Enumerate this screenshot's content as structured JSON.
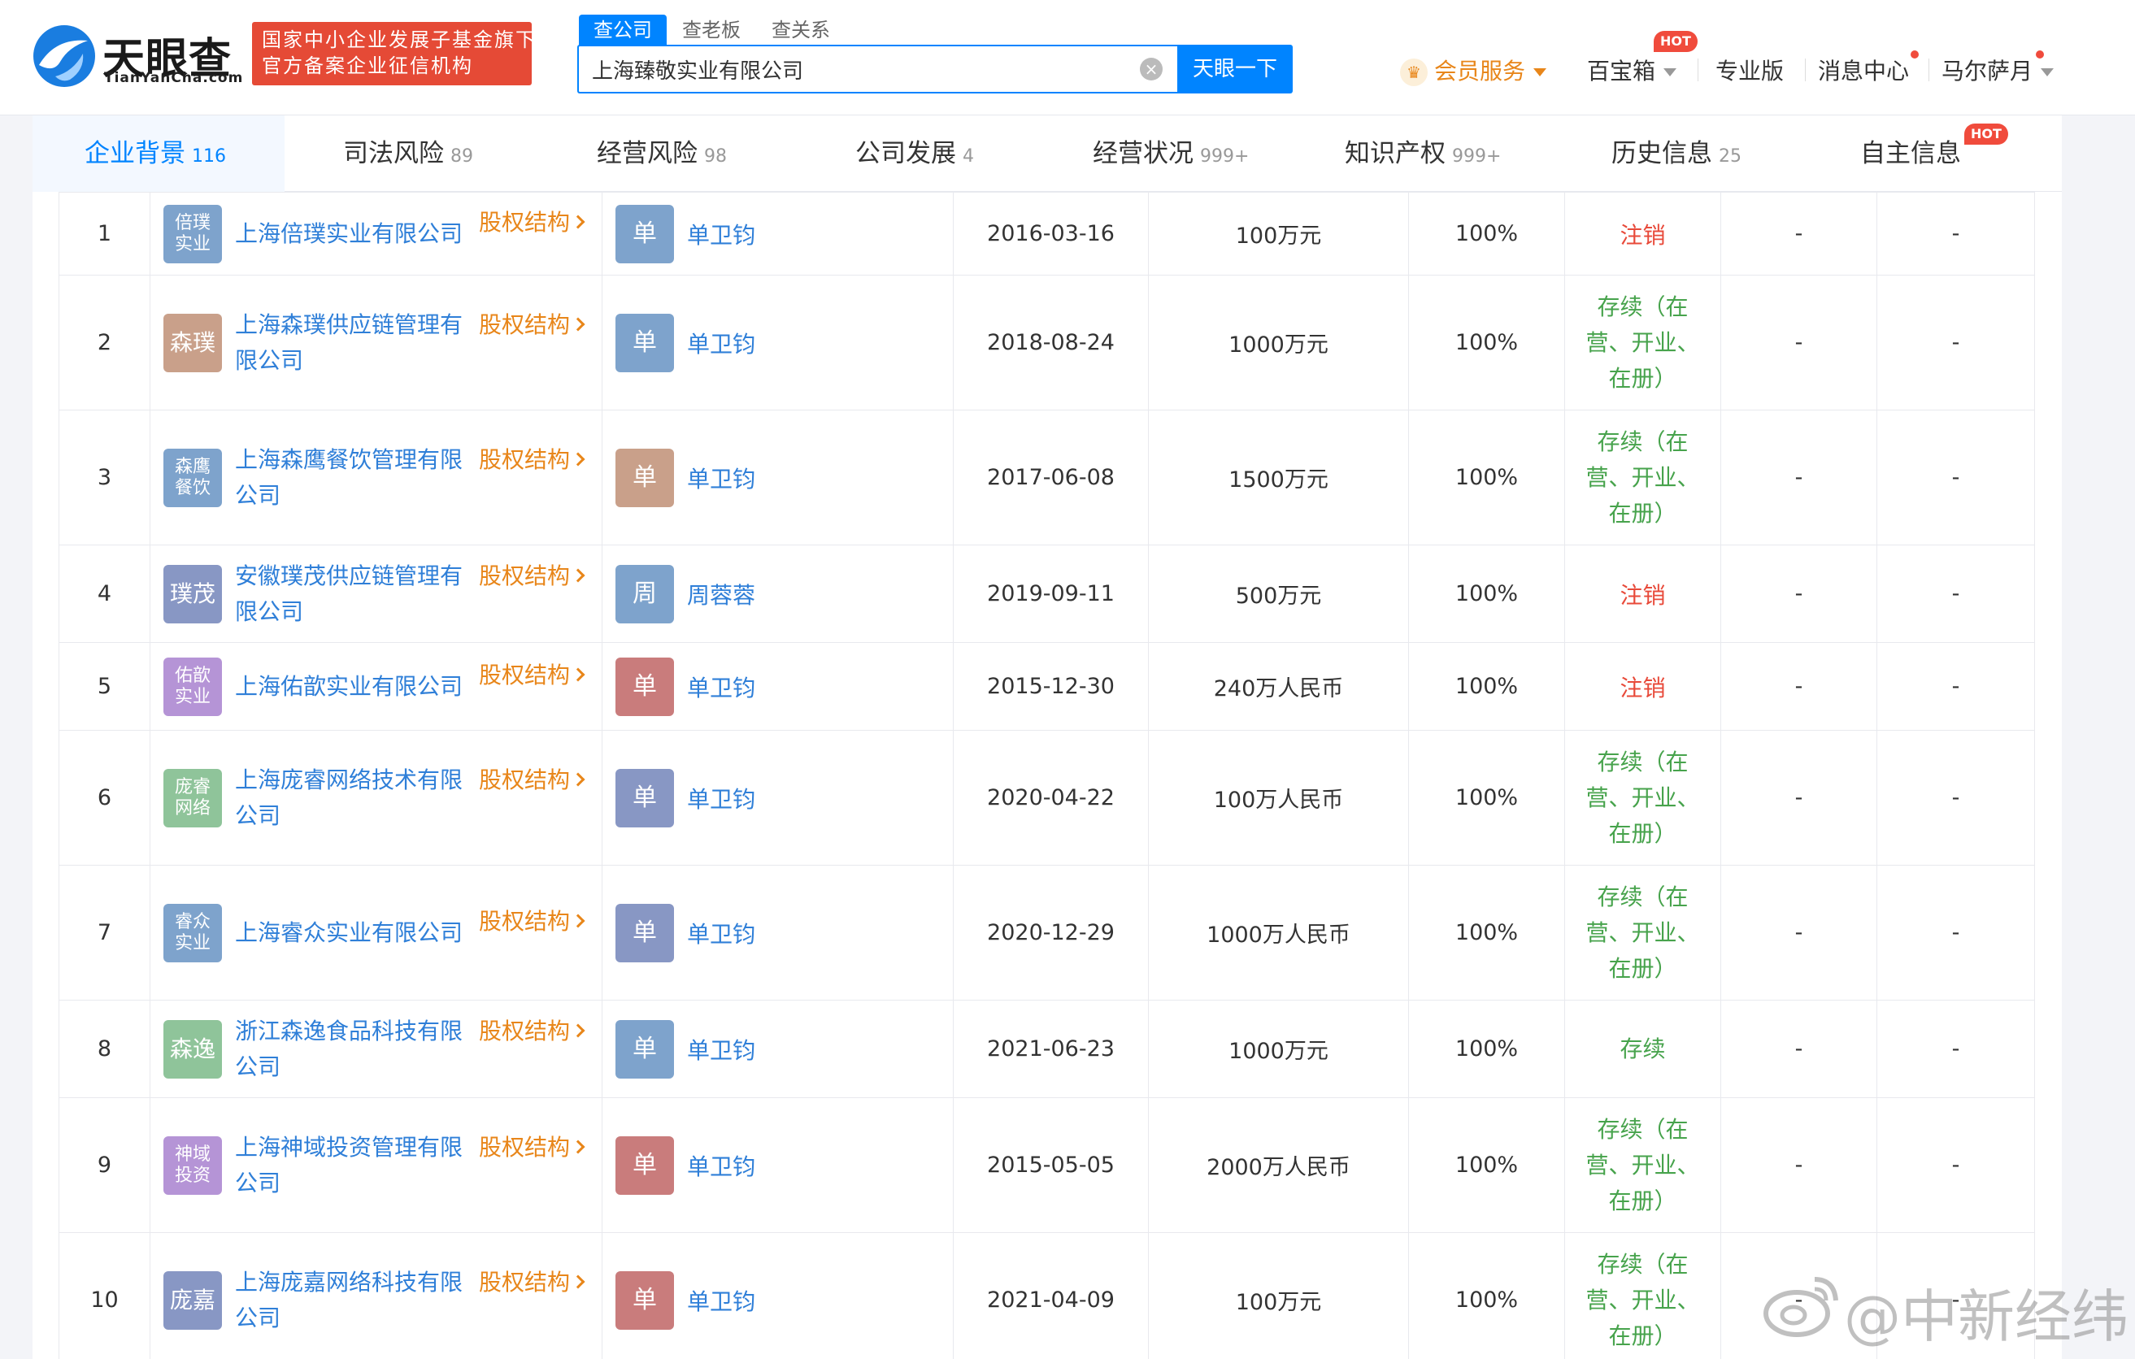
{
  "brand": {
    "name_cn": "天眼查",
    "name_en": "TianYanCha.com",
    "slogan_line1": "国家中小企业发展子基金旗下",
    "slogan_line2": "官方备案企业征信机构"
  },
  "search": {
    "tabs": [
      "查公司",
      "查老板",
      "查关系"
    ],
    "active_tab": "查公司",
    "query": "上海臻敬实业有限公司",
    "button_label": "天眼一下"
  },
  "nav": {
    "vip": "会员服务",
    "toolbox": "百宝箱",
    "hot": "HOT",
    "pro": "专业版",
    "messages": "消息中心",
    "user": "马尔萨月"
  },
  "tabs": [
    {
      "label": "企业背景",
      "count": "116",
      "active": true
    },
    {
      "label": "司法风险",
      "count": "89"
    },
    {
      "label": "经营风险",
      "count": "98"
    },
    {
      "label": "公司发展",
      "count": "4"
    },
    {
      "label": "经营状况",
      "count": "999+"
    },
    {
      "label": "知识产权",
      "count": "999+"
    },
    {
      "label": "历史信息",
      "count": "25"
    },
    {
      "label": "自主信息",
      "count": "",
      "hot": "HOT"
    }
  ],
  "equity_label": "股权结构",
  "rows": [
    {
      "no": "1",
      "avatar": "倍璞实业",
      "avatar_color": "#7ea3cc",
      "company": "上海倍璞实业有限公司",
      "person_avatar": "单",
      "person_color": "#7ea3cc",
      "person": "单卫钧",
      "date": "2016-03-16",
      "capital": "100万元",
      "ratio": "100%",
      "status": "注销",
      "status_type": "red",
      "c8": "-",
      "c9": "-"
    },
    {
      "no": "2",
      "avatar": "森璞",
      "avatar_color": "#c9a08a",
      "company": "上海森璞供应链管理有限公司",
      "person_avatar": "单",
      "person_color": "#7ea3cc",
      "person": "单卫钧",
      "date": "2018-08-24",
      "capital": "1000万元",
      "ratio": "100%",
      "status": "存续（在营、开业、在册）",
      "status_type": "green",
      "c8": "-",
      "c9": "-"
    },
    {
      "no": "3",
      "avatar": "森鹰餐饮",
      "avatar_color": "#7ea3cc",
      "company": "上海森鹰餐饮管理有限公司",
      "person_avatar": "单",
      "person_color": "#c9a08a",
      "person": "单卫钧",
      "date": "2017-06-08",
      "capital": "1500万元",
      "ratio": "100%",
      "status": "存续（在营、开业、在册）",
      "status_type": "green",
      "c8": "-",
      "c9": "-"
    },
    {
      "no": "4",
      "avatar": "璞茂",
      "avatar_color": "#8897c4",
      "company": "安徽璞茂供应链管理有限公司",
      "person_avatar": "周",
      "person_color": "#7ea3cc",
      "person": "周蓉蓉",
      "date": "2019-09-11",
      "capital": "500万元",
      "ratio": "100%",
      "status": "注销",
      "status_type": "red",
      "c8": "-",
      "c9": "-"
    },
    {
      "no": "5",
      "avatar": "佑歆实业",
      "avatar_color": "#b594d6",
      "company": "上海佑歆实业有限公司",
      "person_avatar": "单",
      "person_color": "#c97c7c",
      "person": "单卫钧",
      "date": "2015-12-30",
      "capital": "240万人民币",
      "ratio": "100%",
      "status": "注销",
      "status_type": "red",
      "c8": "-",
      "c9": "-"
    },
    {
      "no": "6",
      "avatar": "庞睿网络",
      "avatar_color": "#8fc49a",
      "company": "上海庞睿网络技术有限公司",
      "person_avatar": "单",
      "person_color": "#8897c4",
      "person": "单卫钧",
      "date": "2020-04-22",
      "capital": "100万人民币",
      "ratio": "100%",
      "status": "存续（在营、开业、在册）",
      "status_type": "green",
      "c8": "-",
      "c9": "-"
    },
    {
      "no": "7",
      "avatar": "睿众实业",
      "avatar_color": "#7ea3cc",
      "company": "上海睿众实业有限公司",
      "person_avatar": "单",
      "person_color": "#8897c4",
      "person": "单卫钧",
      "date": "2020-12-29",
      "capital": "1000万人民币",
      "ratio": "100%",
      "status": "存续（在营、开业、在册）",
      "status_type": "green",
      "c8": "-",
      "c9": "-"
    },
    {
      "no": "8",
      "avatar": "森逸",
      "avatar_color": "#8fc49a",
      "company": "浙江森逸食品科技有限公司",
      "person_avatar": "单",
      "person_color": "#7ea3cc",
      "person": "单卫钧",
      "date": "2021-06-23",
      "capital": "1000万元",
      "ratio": "100%",
      "status": "存续",
      "status_type": "green",
      "c8": "-",
      "c9": "-"
    },
    {
      "no": "9",
      "avatar": "神域投资",
      "avatar_color": "#b594d6",
      "company": "上海神域投资管理有限公司",
      "person_avatar": "单",
      "person_color": "#c97c7c",
      "person": "单卫钧",
      "date": "2015-05-05",
      "capital": "2000万人民币",
      "ratio": "100%",
      "status": "存续（在营、开业、在册）",
      "status_type": "green",
      "c8": "-",
      "c9": "-"
    },
    {
      "no": "10",
      "avatar": "庞嘉",
      "avatar_color": "#8897c4",
      "company": "上海庞嘉网络科技有限公司",
      "person_avatar": "单",
      "person_color": "#c97c7c",
      "person": "单卫钧",
      "date": "2021-04-09",
      "capital": "100万元",
      "ratio": "100%",
      "status": "存续（在营、开业、在册）",
      "status_type": "green",
      "c8": "-",
      "c9": "-"
    }
  ],
  "watermark": "@中新经纬"
}
